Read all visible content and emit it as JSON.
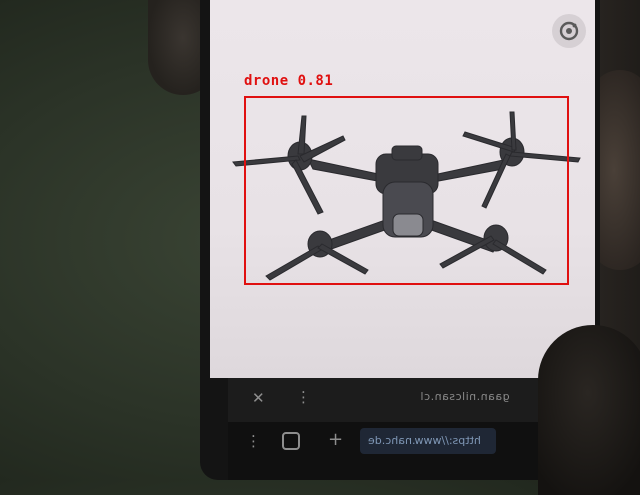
{
  "detection": {
    "label": "drone 0.81",
    "class": "drone",
    "confidence": 0.81,
    "box_color": "#e01010"
  },
  "browser": {
    "tab_text": "gaan.nilcsan.cl",
    "url_text": "https://www.nahc.de",
    "close_icon": "close-icon",
    "menu_icon": "more-vertical-icon",
    "tabs_icon": "tabs-icon",
    "add_icon": "plus-icon",
    "lens_icon": "lens-icon",
    "accent": "#7f97b5"
  }
}
